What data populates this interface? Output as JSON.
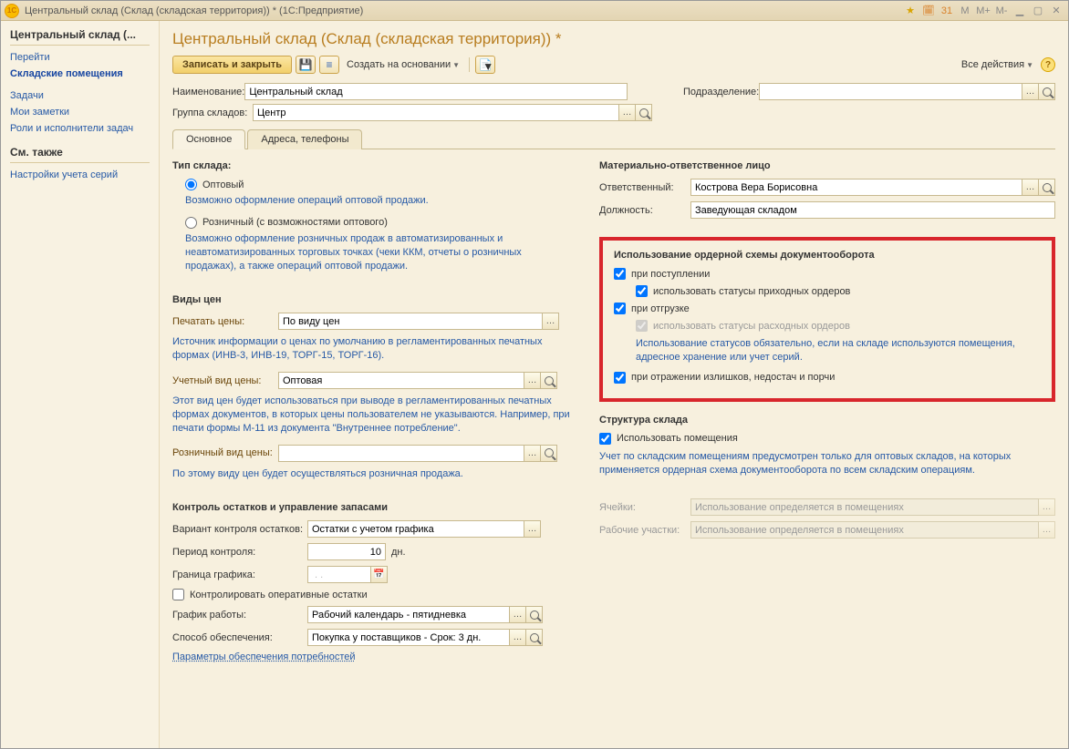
{
  "titlebar": {
    "app_icon_text": "1C",
    "title": "Центральный склад (Склад (складская территория)) *  (1С:Предприятие)"
  },
  "sidebar": {
    "block1_title": "Центральный склад (...",
    "goto": "Перейти",
    "premises": "Складские помещения",
    "tasks": "Задачи",
    "notes": "Мои заметки",
    "roles": "Роли и исполнители задач",
    "block2_title": "См. также",
    "series_settings": "Настройки учета серий"
  },
  "page_title": "Центральный склад (Склад (складская территория)) *",
  "toolbar": {
    "save_close": "Записать и закрыть",
    "create_based": "Создать на основании",
    "all_actions": "Все действия"
  },
  "header": {
    "name_label": "Наименование:",
    "name_value": "Центральный склад",
    "dept_label": "Подразделение:",
    "group_label": "Группа складов:",
    "group_value": "Центр"
  },
  "tabs": {
    "main": "Основное",
    "addr": "Адреса, телефоны"
  },
  "type_section": {
    "title": "Тип склада:",
    "opt_wholesale": "Оптовый",
    "hint_wholesale": "Возможно оформление операций оптовой продажи.",
    "opt_retail": "Розничный (с возможностями оптового)",
    "hint_retail": "Возможно оформление розничных продаж в автоматизированных и неавтоматизированных торговых точках (чеки ККМ, отчеты о розничных продажах), а также операций оптовой продажи."
  },
  "prices_section": {
    "title": "Виды цен",
    "print_label": "Печатать цены:",
    "print_value": "По виду цен",
    "print_hint": "Источник информации о ценах по умолчанию в регламентированных печатных формах (ИНВ-3, ИНВ-19, ТОРГ-15, ТОРГ-16).",
    "acc_label": "Учетный вид цены:",
    "acc_value": "Оптовая",
    "acc_hint": "Этот вид цен будет использоваться при выводе в регламентированных печатных формах документов, в которых цены пользователем не указываются. Например, при печати формы М-11 из документа \"Внутреннее потребление\".",
    "retail_label": "Розничный вид цены:",
    "retail_hint": "По этому виду цен будет осуществляться розничная продажа."
  },
  "stock_section": {
    "title": "Контроль остатков и управление запасами",
    "variant_label": "Вариант контроля остатков:",
    "variant_value": "Остатки с учетом графика",
    "period_label": "Период контроля:",
    "period_value": "10",
    "period_unit": "дн.",
    "border_label": "Граница графика:",
    "border_value": " . .",
    "operative_chk": "Контролировать оперативные остатки",
    "schedule_label": "График работы:",
    "schedule_value": "Рабочий календарь - пятидневка",
    "supply_label": "Способ обеспечения:",
    "supply_value": "Покупка у поставщиков - Срок: 3 дн.",
    "params_link": "Параметры обеспечения потребностей"
  },
  "resp_section": {
    "title": "Материально-ответственное лицо",
    "resp_label": "Ответственный:",
    "resp_value": "Кострова Вера Борисовна",
    "pos_label": "Должность:",
    "pos_value": "Заведующая складом"
  },
  "order_section": {
    "title": "Использование ордерной схемы документооборота",
    "on_receipt": "при поступлении",
    "use_receipt_status": "использовать статусы приходных ордеров",
    "on_shipment": "при отгрузке",
    "use_shipment_status": "использовать статусы расходных ордеров",
    "shipment_hint": "Использование статусов обязательно, если на складе используются помещения, адресное хранение или учет серий.",
    "on_surplus": "при отражении излишков, недостач и порчи"
  },
  "struct_section": {
    "title": "Структура склада",
    "use_premises": "Использовать помещения",
    "struct_hint": "Учет по складским помещениям предусмотрен только для оптовых складов, на которых применяется ордерная схема документооборота по всем складским операциям.",
    "cells_label": "Ячейки:",
    "cells_value": "Использование определяется в помещениях",
    "areas_label": "Рабочие участки:",
    "areas_value": "Использование определяется в помещениях"
  }
}
